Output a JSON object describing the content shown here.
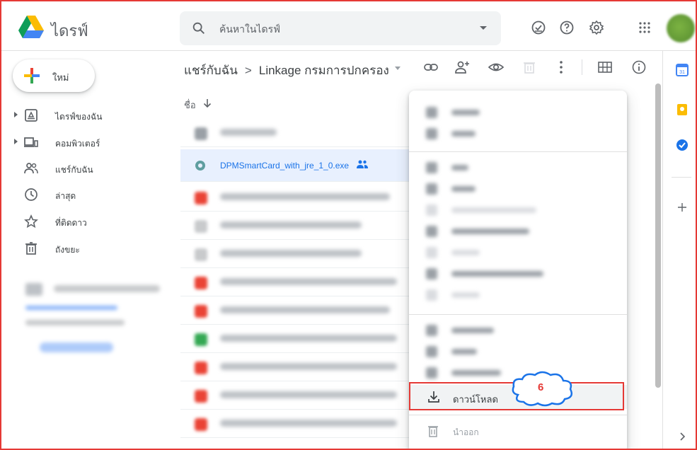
{
  "header": {
    "app_title": "ไดรฟ์",
    "search_placeholder": "ค้นหาในไดรฟ์"
  },
  "sidebar": {
    "new_label": "ใหม่",
    "items": [
      {
        "label": "ไดรฟ์ของฉัน",
        "icon": "my-drive-icon"
      },
      {
        "label": "คอมพิวเตอร์",
        "icon": "computer-icon"
      },
      {
        "label": "แชร์กับฉัน",
        "icon": "shared-icon"
      },
      {
        "label": "ล่าสุด",
        "icon": "clock-icon"
      },
      {
        "label": "ที่ติดดาว",
        "icon": "star-icon"
      },
      {
        "label": "ถังขยะ",
        "icon": "trash-icon"
      }
    ]
  },
  "breadcrumb": {
    "root": "แชร์กับฉัน",
    "separator": ">",
    "current": "Linkage กรมการปกครอง"
  },
  "list": {
    "name_header": "ชื่อ",
    "selected_file": "DPMSmartCard_with_jre_1_0.exe"
  },
  "context_menu": {
    "download_label": "ดาวน์โหลด",
    "remove_label": "นำออก"
  },
  "annotation": {
    "step_number": "6"
  },
  "colors": {
    "accent": "#1a73e8",
    "highlight_box": "#e53935",
    "selected_row": "#e8f0fe"
  }
}
